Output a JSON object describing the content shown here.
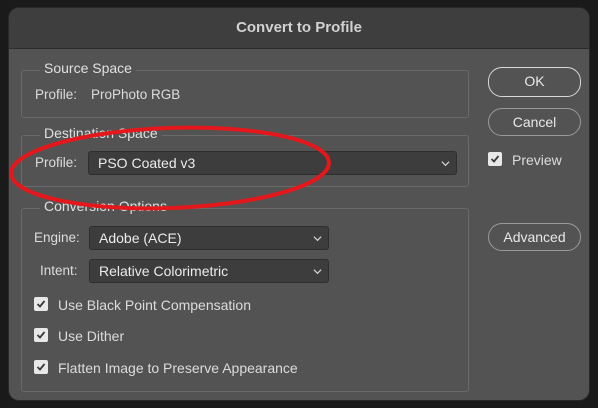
{
  "dialog": {
    "title": "Convert to Profile"
  },
  "source_space": {
    "title": "Source Space",
    "profile_label": "Profile:",
    "profile_value": "ProPhoto RGB"
  },
  "destination_space": {
    "title": "Destination Space",
    "profile_label": "Profile:",
    "profile_selected": "PSO Coated v3"
  },
  "conversion_options": {
    "title": "Conversion Options",
    "engine_label": "Engine:",
    "engine_selected": "Adobe (ACE)",
    "intent_label": "Intent:",
    "intent_selected": "Relative Colorimetric",
    "checkboxes": [
      {
        "label": "Use Black Point Compensation",
        "checked": true
      },
      {
        "label": "Use Dither",
        "checked": true
      },
      {
        "label": "Flatten Image to Preserve Appearance",
        "checked": true
      }
    ]
  },
  "buttons": {
    "ok": "OK",
    "cancel": "Cancel",
    "advanced": "Advanced"
  },
  "preview": {
    "label": "Preview",
    "checked": true
  },
  "colors": {
    "dialog_bg": "#535353",
    "titlebar_bg": "#3e3e3e",
    "annotation_red": "#e4181c"
  }
}
